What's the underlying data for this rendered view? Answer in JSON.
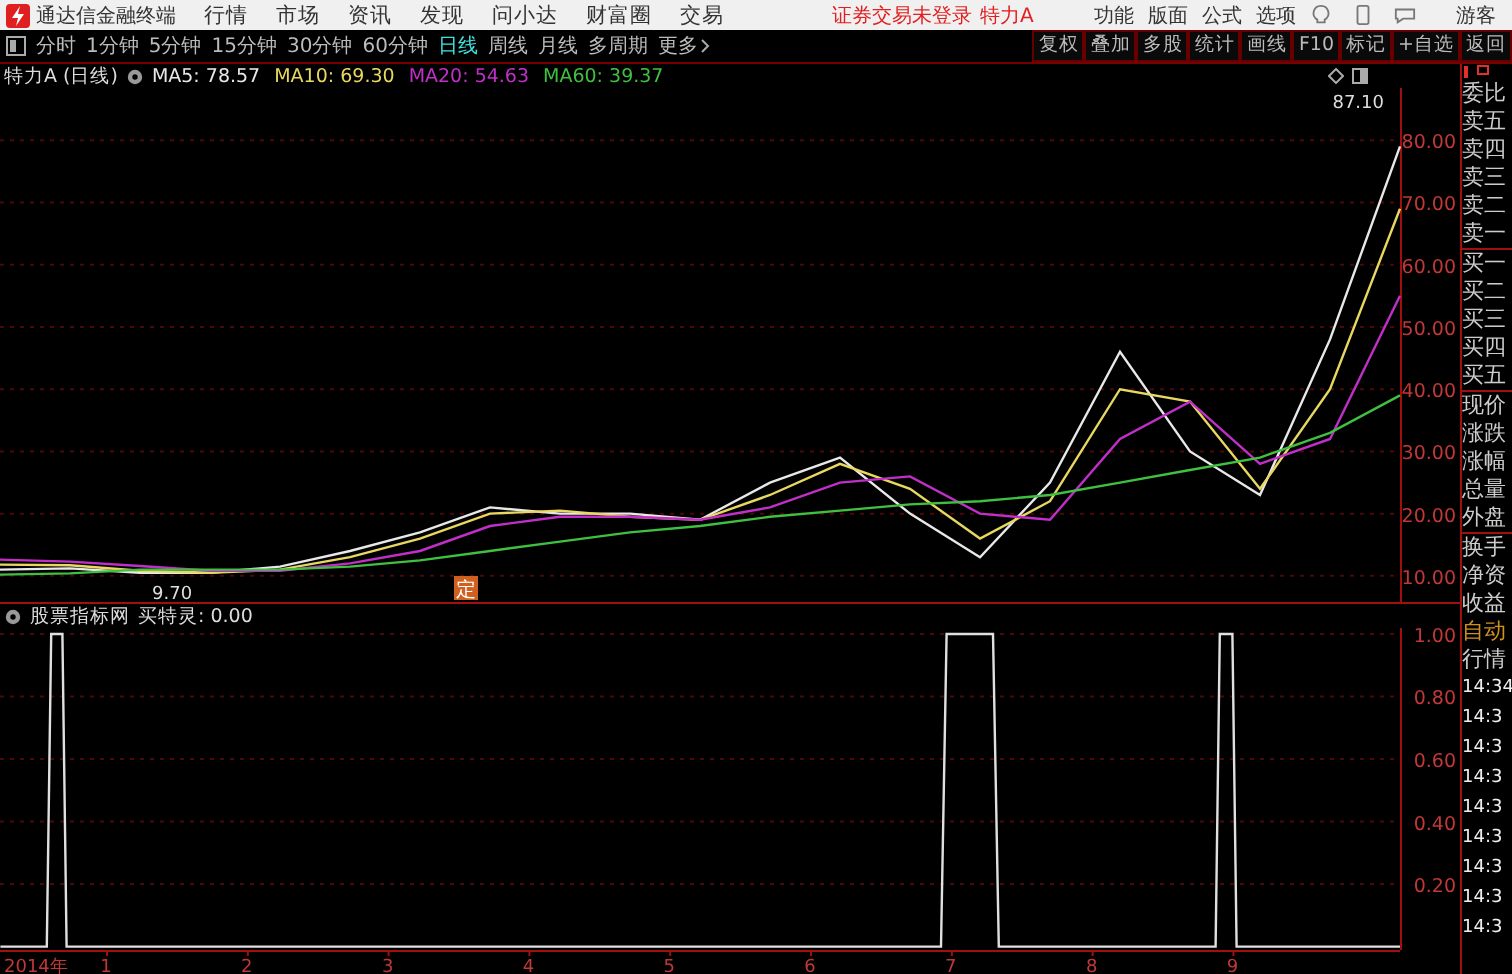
{
  "menubar": {
    "app_title": "通达信金融终端",
    "menus": [
      "行情",
      "市场",
      "资讯",
      "发现",
      "问小达",
      "财富圈",
      "交易"
    ],
    "status": "证券交易未登录",
    "stock": "特力A",
    "right_menus": [
      "功能",
      "版面",
      "公式",
      "选项"
    ],
    "user": "游客"
  },
  "toolbar": {
    "periods": [
      {
        "label": "分时",
        "selected": false
      },
      {
        "label": "1分钟",
        "selected": false
      },
      {
        "label": "5分钟",
        "selected": false
      },
      {
        "label": "15分钟",
        "selected": false
      },
      {
        "label": "30分钟",
        "selected": false
      },
      {
        "label": "60分钟",
        "selected": false
      },
      {
        "label": "日线",
        "selected": true
      },
      {
        "label": "周线",
        "selected": false
      },
      {
        "label": "月线",
        "selected": false
      },
      {
        "label": "多周期",
        "selected": false
      },
      {
        "label": "更多",
        "selected": false
      }
    ],
    "tools": [
      "复权",
      "叠加",
      "多股",
      "统计",
      "画线",
      "F10",
      "标记",
      "+自选",
      "返回"
    ]
  },
  "price_panel": {
    "stock": "特力A",
    "period": "(日线)",
    "ma_readings": [
      "78.57",
      "69.30",
      "54.63",
      "39.37"
    ],
    "max_label": "87.10",
    "min_label": "9.70",
    "marker": "定",
    "chart_data": {
      "type": "line",
      "grid": true,
      "categories": [
        null,
        null,
        null,
        null,
        null,
        null,
        null,
        null,
        null,
        null,
        null,
        null,
        null,
        null,
        null,
        null,
        null,
        null,
        null,
        null,
        null
      ],
      "ylim": [
        5.8,
        88.4
      ],
      "yticks": [
        {
          "value": 10,
          "label": "10.00"
        },
        {
          "value": 20,
          "label": "20.00"
        },
        {
          "value": 30,
          "label": "30.00"
        },
        {
          "value": 40,
          "label": "40.00"
        },
        {
          "value": 50,
          "label": "50.00"
        },
        {
          "value": 60,
          "label": "60.00"
        },
        {
          "value": 70,
          "label": "70.00"
        },
        {
          "value": 80,
          "label": "80.00"
        }
      ],
      "series": [
        {
          "name": "MA5:",
          "color": "#e8e8e8",
          "values": [
            11,
            11.2,
            10.5,
            10.5,
            11.5,
            14,
            17,
            21,
            20,
            20,
            19,
            25,
            29,
            20,
            13,
            25,
            46,
            30,
            23,
            48,
            79
          ]
        },
        {
          "name": "MA10:",
          "color": "#e8d860",
          "values": [
            11.8,
            11.7,
            10.8,
            10.5,
            11,
            13,
            16,
            20,
            20.5,
            19.5,
            19,
            23,
            28,
            24,
            16,
            22,
            40,
            38,
            24,
            40,
            69
          ]
        },
        {
          "name": "MA20:",
          "color": "#c030c8",
          "values": [
            12.6,
            12.3,
            11.6,
            10.8,
            10.8,
            12,
            14,
            18,
            19.5,
            19.5,
            19,
            21,
            25,
            26,
            20,
            19,
            32,
            38,
            28,
            32,
            55
          ]
        },
        {
          "name": "MA60:",
          "color": "#40c040",
          "values": [
            10.2,
            10.4,
            11,
            11,
            11,
            11.5,
            12.5,
            14,
            15.5,
            17,
            18,
            19.5,
            20.5,
            21.5,
            22,
            23,
            25,
            27,
            29,
            33,
            39
          ]
        }
      ]
    }
  },
  "indicator_panel": {
    "source": "股票指标网",
    "reading": "0.00",
    "year_label": "2014年",
    "chart_data": {
      "type": "line",
      "grid": true,
      "x": [
        0.25,
        0.58,
        0.61,
        0.69,
        0.72,
        6.93,
        6.97,
        7.3,
        7.34,
        8.88,
        8.91,
        9.0,
        9.03,
        10.19
      ],
      "xlim": [
        0.247,
        10.19
      ],
      "ylim": [
        -0.011,
        1.019
      ],
      "yticks": [
        {
          "value": 0.2,
          "label": "0.20"
        },
        {
          "value": 0.4,
          "label": "0.40"
        },
        {
          "value": 0.6,
          "label": "0.60"
        },
        {
          "value": 0.8,
          "label": "0.80"
        },
        {
          "value": 1,
          "label": "1.00"
        }
      ],
      "xticks": [
        1,
        2,
        3,
        4,
        5,
        6,
        7,
        8,
        9
      ],
      "series": [
        {
          "name": "买特灵:",
          "color": "#e0e0e0",
          "values": [
            0,
            0,
            1,
            1,
            0,
            0,
            1,
            1,
            0,
            0,
            1,
            1,
            0,
            0
          ]
        }
      ]
    }
  },
  "quote_column": {
    "labels": [
      "委比",
      "卖五",
      "卖四",
      "卖三",
      "卖二",
      "卖一",
      "买一",
      "买二",
      "买三",
      "买四",
      "买五",
      "现价",
      "涨跌",
      "涨幅",
      "总量",
      "外盘",
      "换手",
      "净资",
      "收益"
    ],
    "mode": "自动",
    "section": "行情",
    "times": [
      "14:34",
      "14:3",
      "14:3",
      "14:3",
      "14:3",
      "14:3",
      "14:3",
      "14:3",
      "14:3"
    ]
  }
}
